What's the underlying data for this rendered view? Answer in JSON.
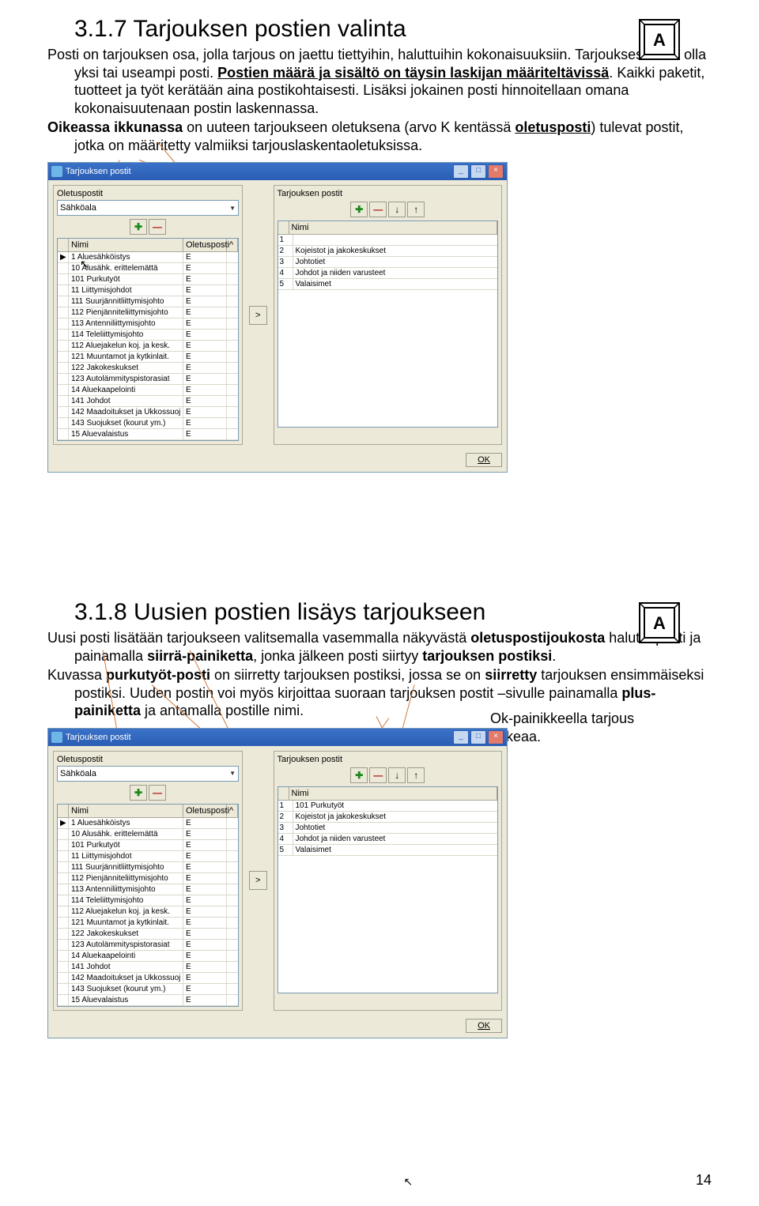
{
  "page_number": "14",
  "section1": {
    "title": "3.1.7 Tarjouksen postien valinta",
    "p1a": "Posti on tarjouksen osa, jolla tarjous on jaettu tiettyihin, haluttuihin",
    "p1b": "kokonaisuuksiin. Tarjouksessa voi olla yksi tai useampi posti. ",
    "p1c_u": "Postien määrä ja sisältö on täysin laskijan määriteltävissä",
    "p1d": ". Kaikki paketit, tuotteet ja työt kerätään aina postikohtaisesti. Lisäksi jokainen posti hinnoitellaan omana kokonaisuutenaan postin laskennassa.",
    "p2a": "Oikeassa ikkunassa",
    "p2b": " on uuteen tarjoukseen oletuksena (arvo K kentässä ",
    "p2c_u": "oletusposti",
    "p2d": ") tulevat postit, jotka on määritetty valmiiksi tarjouslaskentaoletuksissa."
  },
  "section2": {
    "title": "3.1.8 Uusien postien lisäys tarjoukseen",
    "p1": "Uusi posti lisätään tarjoukseen valitsemalla vasemmalla näkyvästä ",
    "p1b": "oletuspostijoukosta",
    "p1c": " haluttu posti ja painamalla ",
    "p1d": "siirrä-painiketta",
    "p1e": ", jonka jälkeen posti siirtyy ",
    "p1f": "tarjouksen postiksi",
    "p1g": ".",
    "p2a": "Kuvassa ",
    "p2b": "purkutyöt-posti",
    "p2c": " on siirretty tarjouksen postiksi, jossa se on ",
    "p2d": "siirretty",
    "p2e": " tarjouksen ensimmäiseksi postiksi. Uuden postin voi myös kirjoittaa suoraan tarjouksen postit –sivulle painamalla ",
    "p2f": "plus-painiketta",
    "p2g": " ja antamalla postille nimi.",
    "p3": "Ok-painikkeella tarjous aukeaa."
  },
  "dialog": {
    "title": "Tarjouksen postit",
    "left_label": "Oletuspostit",
    "right_label": "Tarjouksen postit",
    "dropdown": "Sähköala",
    "col_nimi": "Nimi",
    "col_oletus": "Oletusposti",
    "ok": "OK",
    "left_rows1": [
      {
        "n": "1",
        "t": "Aluesähköistys",
        "o": "E"
      },
      {
        "n": "10",
        "t": "Alusähk. erittelemättä",
        "o": "E"
      },
      {
        "n": "101",
        "t": "Purkutyöt",
        "o": "E"
      },
      {
        "n": "11",
        "t": "Liittymisjohdot",
        "o": "E"
      },
      {
        "n": "111",
        "t": "Suurjännitliittymisjohto",
        "o": "E"
      },
      {
        "n": "112",
        "t": "Pienjänniteliittymisjohto",
        "o": "E"
      },
      {
        "n": "113",
        "t": "Antenniliittymisjohto",
        "o": "E"
      },
      {
        "n": "114",
        "t": "Teleliittymisjohto",
        "o": "E"
      },
      {
        "n": "112",
        "t": "Aluejakelun koj. ja kesk.",
        "o": "E"
      },
      {
        "n": "121",
        "t": "Muuntamot ja kytkinlait.",
        "o": "E"
      },
      {
        "n": "122",
        "t": "Jakokeskukset",
        "o": "E"
      },
      {
        "n": "123",
        "t": "Autolämmityspistorasiat",
        "o": "E"
      },
      {
        "n": "14",
        "t": "Aluekaapelointi",
        "o": "E"
      },
      {
        "n": "141",
        "t": "Johdot",
        "o": "E"
      },
      {
        "n": "142",
        "t": "Maadoitukset ja Ukkossuoj",
        "o": "E"
      },
      {
        "n": "143",
        "t": "Suojukset (kourut ym.)",
        "o": "E"
      },
      {
        "n": "15",
        "t": "Aluevalaistus",
        "o": "E"
      }
    ],
    "right_rows1": [
      {
        "n": "1",
        "t": ""
      },
      {
        "n": "2",
        "t": "Kojeistot ja jakokeskukset"
      },
      {
        "n": "3",
        "t": "Johtotiet"
      },
      {
        "n": "4",
        "t": "Johdot ja niiden varusteet"
      },
      {
        "n": "5",
        "t": "Valaisimet"
      }
    ],
    "left_rows2": [
      {
        "n": "1",
        "t": "Aluesähköistys",
        "o": "E"
      },
      {
        "n": "10",
        "t": "Alusähk. erittelemättä",
        "o": "E"
      },
      {
        "n": "101",
        "t": "Purkutyöt",
        "o": "E"
      },
      {
        "n": "11",
        "t": "Liittymisjohdot",
        "o": "E"
      },
      {
        "n": "111",
        "t": "Suurjännitliittymisjohto",
        "o": "E"
      },
      {
        "n": "112",
        "t": "Pienjänniteliittymisjohto",
        "o": "E"
      },
      {
        "n": "113",
        "t": "Antenniliittymisjohto",
        "o": "E"
      },
      {
        "n": "114",
        "t": "Teleliittymisjohto",
        "o": "E"
      },
      {
        "n": "112",
        "t": "Aluejakelun koj. ja kesk.",
        "o": "E"
      },
      {
        "n": "121",
        "t": "Muuntamot ja kytkinlait.",
        "o": "E"
      },
      {
        "n": "122",
        "t": "Jakokeskukset",
        "o": "E"
      },
      {
        "n": "123",
        "t": "Autolämmityspistorasiat",
        "o": "E"
      },
      {
        "n": "14",
        "t": "Aluekaapelointi",
        "o": "E"
      },
      {
        "n": "141",
        "t": "Johdot",
        "o": "E"
      },
      {
        "n": "142",
        "t": "Maadoitukset ja Ukkossuoj",
        "o": "E"
      },
      {
        "n": "143",
        "t": "Suojukset (kourut ym.)",
        "o": "E"
      },
      {
        "n": "15",
        "t": "Aluevalaistus",
        "o": "E"
      }
    ],
    "right_rows2": [
      {
        "n": "1",
        "t": "101 Purkutyöt"
      },
      {
        "n": "2",
        "t": "Kojeistot ja jakokeskukset"
      },
      {
        "n": "3",
        "t": "Johtotiet"
      },
      {
        "n": "4",
        "t": "Johdot ja niiden varusteet"
      },
      {
        "n": "5",
        "t": "Valaisimet"
      }
    ]
  },
  "icons": {
    "plus": "✚",
    "minus": "—",
    "down": "↓",
    "up": "↑",
    "right": ">"
  }
}
